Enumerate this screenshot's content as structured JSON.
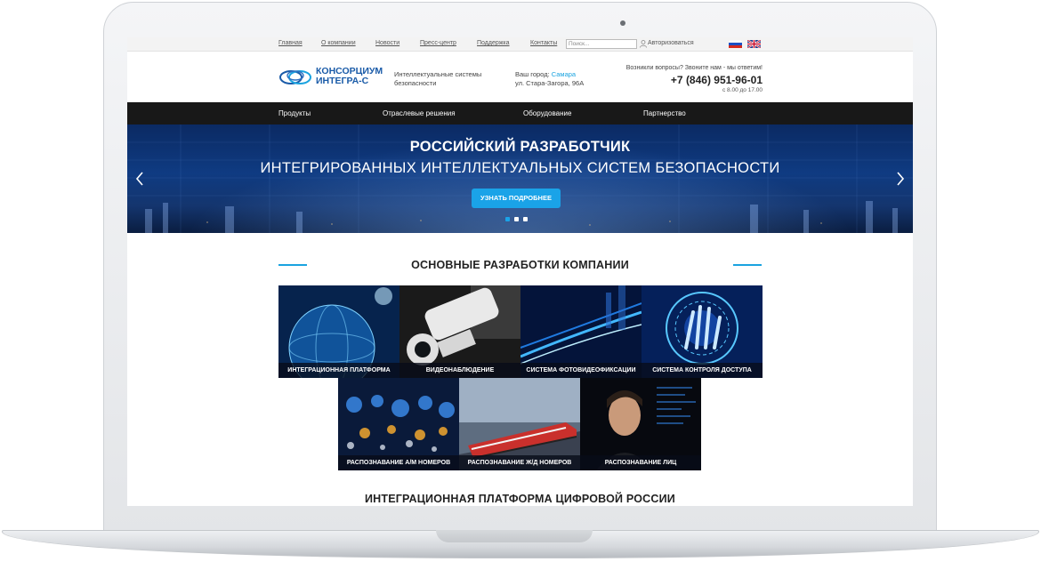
{
  "topbar": {
    "links": [
      "Главная",
      "О компании",
      "Новости",
      "Пресс-центр",
      "Поддержка",
      "Контакты"
    ],
    "search_placeholder": "Поиск...",
    "login_label": "Авторизоваться",
    "flags": [
      "russia-flag",
      "uk-flag"
    ]
  },
  "header": {
    "logo_line1": "КОНСОРЦИУМ",
    "logo_line2": "ИНТЕГРА-С",
    "tagline_line1": "Интеллектуальные системы",
    "tagline_line2": "безопасности",
    "city_prefix": "Ваш город:",
    "city_name": "Самара",
    "address": "ул. Стара-Загора, 96А",
    "contact_question": "Возникли вопросы? Звоните нам - мы ответим!",
    "phone": "+7 (846) 951-96-01",
    "hours": "с 8.00 до 17.00"
  },
  "nav": {
    "items": [
      "Продукты",
      "Отраслевые решения",
      "Оборудование",
      "Партнерство"
    ]
  },
  "hero": {
    "title_line1": "РОССИЙСКИЙ РАЗРАБОТЧИК",
    "title_line2": "ИНТЕГРИРОВАННЫХ ИНТЕЛЛЕКТУАЛЬНЫХ СИСТЕМ БЕЗОПАСНОСТИ",
    "button_label": "УЗНАТЬ ПОДРОБНЕЕ",
    "slide_count": 3,
    "active_slide": 1
  },
  "developments": {
    "title": "ОСНОВНЫЕ РАЗРАБОТКИ КОМПАНИИ",
    "tiles": [
      "ИНТЕГРАЦИОННАЯ ПЛАТФОРМА",
      "ВИДЕОНАБЛЮДЕНИЕ",
      "СИСТЕМА ФОТОВИДЕОФИКСАЦИИ",
      "СИСТЕМА КОНТРОЛЯ ДОСТУПА",
      "РАСПОЗНАВАНИЕ А/М НОМЕРОВ",
      "РАСПОЗНАВАНИЕ Ж/Д НОМЕРОВ",
      "РАСПОЗНАВАНИЕ ЛИЦ"
    ]
  },
  "platform": {
    "title": "ИНТЕГРАЦИОННАЯ ПЛАТФОРМА ЦИФРОВОЙ РОССИИ"
  },
  "colors": {
    "accent": "#1aa3e0",
    "brand": "#1a5ba8",
    "nav_bg": "#181818"
  }
}
